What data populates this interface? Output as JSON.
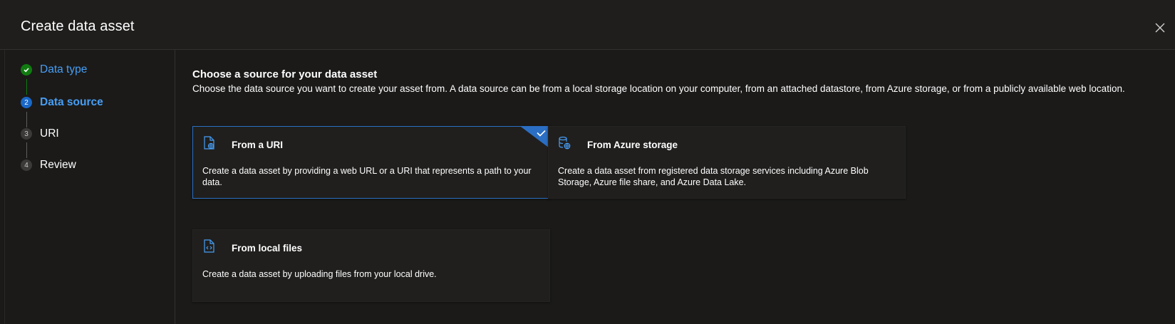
{
  "dialog": {
    "title": "Create data asset",
    "close_icon": "close-icon"
  },
  "steps": [
    {
      "number": "",
      "label": "Data type",
      "state": "completed",
      "icon": "checkmark-icon"
    },
    {
      "number": "2",
      "label": "Data source",
      "state": "current"
    },
    {
      "number": "3",
      "label": "URI",
      "state": "pending"
    },
    {
      "number": "4",
      "label": "Review",
      "state": "pending"
    }
  ],
  "content": {
    "heading": "Choose a source for your data asset",
    "description": "Choose the data source you want to create your asset from. A data source can be from a local storage location on your computer, from an attached datastore, from Azure storage, or from a publicly available web location.",
    "options": [
      {
        "title": "From a URI",
        "description": "Create a data asset by providing a web URL or a URI that represents a path to your data.",
        "icon": "uri-file-icon",
        "selected": true
      },
      {
        "title": "From Azure storage",
        "description": "Create a data asset from registered data storage services including Azure Blob Storage, Azure file share, and Azure Data Lake.",
        "icon": "database-storage-icon",
        "selected": false
      },
      {
        "title": "From local files",
        "description": "Create a data asset by uploading files from your local drive.",
        "icon": "code-file-icon",
        "selected": false
      }
    ]
  },
  "colors": {
    "accent": "#479ef5",
    "selected_border": "#2b6fc4",
    "success": "#107c10",
    "background": "#1b1a19"
  }
}
